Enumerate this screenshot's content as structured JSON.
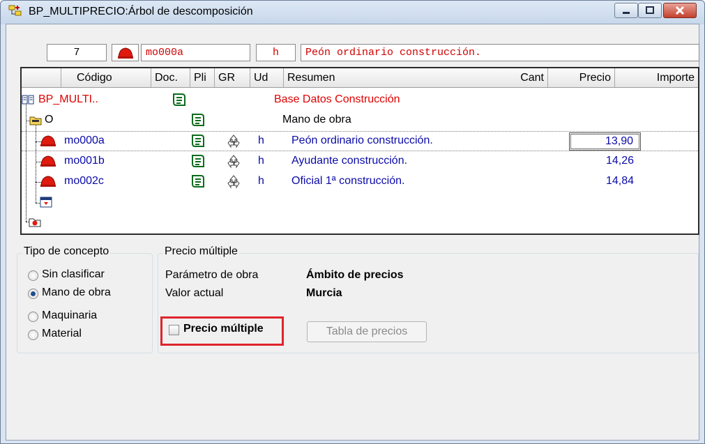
{
  "window": {
    "title": "BP_MULTIPRECIO:Árbol de descomposición",
    "controls": [
      "minimize-icon",
      "maximize-icon",
      "close-icon"
    ]
  },
  "info_bar": {
    "number": "7",
    "code": "mo000a",
    "unit": "h",
    "summary": "Peón ordinario construcción."
  },
  "grid": {
    "columns": [
      "Código",
      "Doc.",
      "Pli",
      "GR",
      "Ud",
      "Resumen",
      "Cant",
      "Precio",
      "Importe"
    ],
    "rows": [
      {
        "code": "BP_MULTI..",
        "unit": "",
        "summary": "Base Datos Construcción",
        "price": "",
        "icon": "books-icon",
        "color": "#e00000"
      },
      {
        "code": "O",
        "unit": "",
        "summary": "Mano de obra",
        "price": "",
        "icon": "folder-icon",
        "color": "#000000"
      },
      {
        "code": "mo000a",
        "unit": "h",
        "summary": "Peón ordinario construcción.",
        "price": "13,90",
        "icon": "helmet-icon",
        "color": "#0a0aa8"
      },
      {
        "code": "mo001b",
        "unit": "h",
        "summary": "Ayudante construcción.",
        "price": "14,26",
        "icon": "helmet-icon",
        "color": "#0a0aa8"
      },
      {
        "code": "mo002c",
        "unit": "h",
        "summary": "Oficial 1ª construcción.",
        "price": "14,84",
        "icon": "helmet-icon",
        "color": "#0a0aa8"
      }
    ]
  },
  "concept_type": {
    "title": "Tipo de concepto",
    "options": [
      "Sin clasificar",
      "Mano de obra",
      "Maquinaria",
      "Material"
    ],
    "selected": "Mano de obra"
  },
  "multi_price": {
    "title": "Precio múltiple",
    "param_label": "Parámetro de obra",
    "param_value": "Ámbito de precios",
    "current_label": "Valor actual",
    "current_value": "Murcia",
    "checkbox_label": "Precio múltiple",
    "checkbox_checked": false,
    "table_button": "Tabla de precios"
  },
  "colors": {
    "accent_red": "#e00000",
    "text_blue": "#0a0aa8",
    "highlight": "#e0242c"
  }
}
